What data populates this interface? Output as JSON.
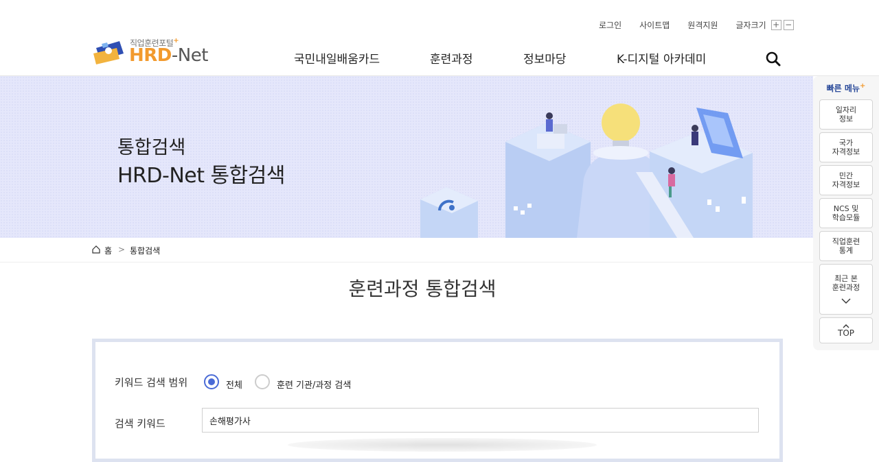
{
  "header": {
    "util_links": [
      "로그인",
      "사이트맵",
      "원격지원"
    ],
    "font_size_label": "글자크기",
    "font_inc": "+",
    "font_dec": "−",
    "logo_sub": "직업훈련포털",
    "logo_plus": "+",
    "logo_hrd": "HRD",
    "logo_net": "-Net",
    "nav": [
      "국민내일배움카드",
      "훈련과정",
      "정보마당",
      "K-디지털 아카데미"
    ]
  },
  "banner": {
    "title1": "통합검색",
    "title2": "HRD-Net 통합검색"
  },
  "breadcrumb": {
    "home": "홈",
    "separator": ">",
    "current": "통합검색"
  },
  "page_title": "훈련과정 통합검색",
  "search": {
    "scope_label": "키워드 검색 범위",
    "scope_options": [
      {
        "label": "전체",
        "selected": true
      },
      {
        "label": "훈련 기관/과정 검색",
        "selected": false
      }
    ],
    "keyword_label": "검색 키워드",
    "keyword_value": "손해평가사"
  },
  "quick_menu": {
    "title": "빠른 메뉴",
    "title_plus": "+",
    "items": [
      {
        "line1": "일자리",
        "line2": "정보"
      },
      {
        "line1": "국가",
        "line2": "자격정보"
      },
      {
        "line1": "민간",
        "line2": "자격정보"
      },
      {
        "line1": "NCS 및",
        "line2": "학습모듈"
      },
      {
        "line1": "직업훈련",
        "line2": "통계"
      },
      {
        "line1": "최근 본",
        "line2": "훈련과정"
      }
    ],
    "top_label": "TOP"
  },
  "colors": {
    "accent_blue": "#4a6bd6",
    "logo_orange": "#f29a2e",
    "banner_bg": "#e5e7fb",
    "search_border": "#dde2f0"
  }
}
